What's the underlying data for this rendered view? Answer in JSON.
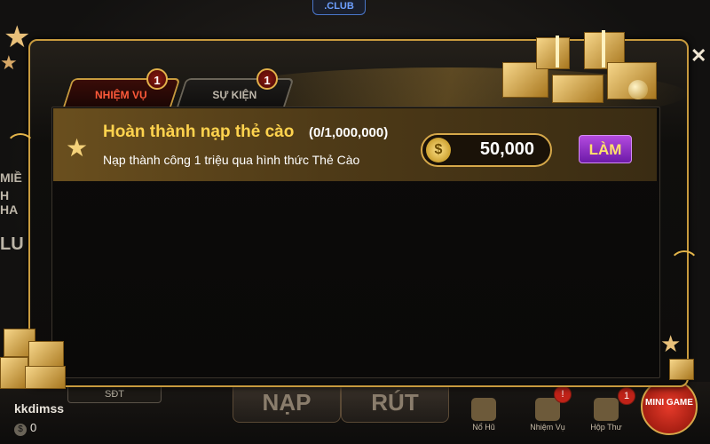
{
  "background": {
    "club_tag": ".CLUB",
    "side_texts": [
      "MIỀ",
      "H HA",
      "LU"
    ]
  },
  "dialog": {
    "tabs": [
      {
        "label": "NHIỆM VỤ",
        "badge": "1",
        "active": true
      },
      {
        "label": "SỰ KIỆN",
        "badge": "1",
        "active": false
      }
    ],
    "mission": {
      "title": "Hoàn thành nạp thẻ cào",
      "progress": "(0/1,000,000)",
      "description": "Nạp thành công 1 triệu qua hình thức Thẻ Cào",
      "reward_icon": "coin-icon",
      "reward_coin_symbol": "$",
      "reward": "50,000",
      "action_label": "LÀM"
    },
    "close_icon": "close-icon"
  },
  "footer": {
    "username": "kkdimss",
    "balance": "0",
    "balance_symbol": "$",
    "phone_label": "SĐT",
    "deposit_label": "NẠP",
    "withdraw_label": "RÚT",
    "nav": [
      {
        "label": "Nổ Hũ",
        "icon": "slot-machine-icon"
      },
      {
        "label": "Nhiệm Vụ",
        "icon": "gift-icon",
        "badge": "!"
      },
      {
        "label": "Hộp Thư",
        "icon": "mail-icon",
        "badge": "1"
      }
    ],
    "mini_game_label": "MINI GAME"
  },
  "colors": {
    "gold": "#c79a3e",
    "active_tab_text": "#ff5a3a",
    "title_yellow": "#ffd34e",
    "action_purple": "#8a2ac4"
  }
}
